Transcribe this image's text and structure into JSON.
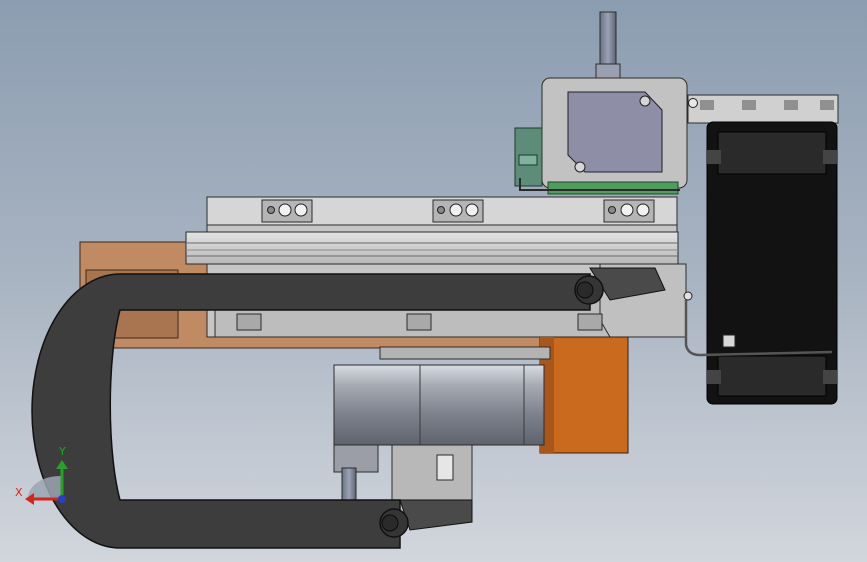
{
  "viewport": {
    "background_top": "#8c9db1",
    "background_bottom": "#d2d6dd"
  },
  "model": {
    "colors": {
      "frame_gray": "#c6c6c6",
      "rail_gray": "#d4d4d4",
      "chain_dark": "#3d3d3d",
      "bracket_brown": "#c08a63",
      "motor_orange": "#c96a1f",
      "motor_body": "#8f929b",
      "servo_blue": "#8e8fa6",
      "pcb_green": "#4f9c5e",
      "fan_black": "#121212"
    }
  },
  "triad": {
    "x_label": "X",
    "y_label": "Y",
    "x_color": "#d0261b",
    "y_color": "#2aa02a",
    "z_color": "#2a3fc0"
  }
}
